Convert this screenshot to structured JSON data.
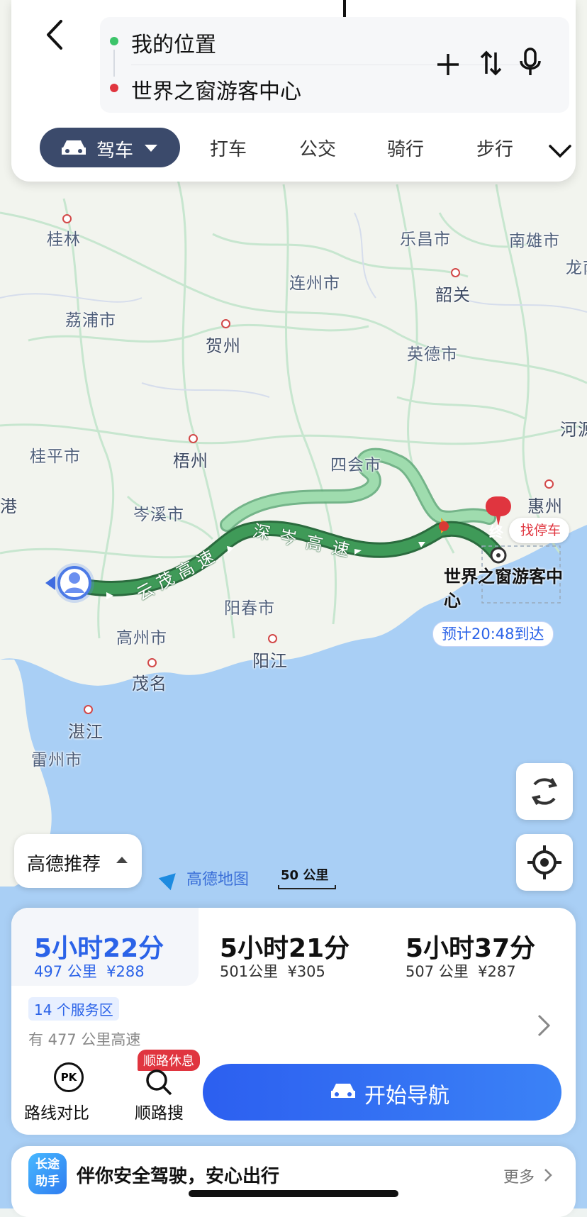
{
  "header": {
    "origin": "我的位置",
    "destination": "世界之窗游客中心",
    "modes": {
      "active": "驾车",
      "taxi": "打车",
      "bus": "公交",
      "bike": "骑行",
      "walk": "步行"
    }
  },
  "map": {
    "cities": [
      "桂林",
      "乐昌市",
      "南雄市",
      "龙南",
      "连州市",
      "韶关",
      "荔浦市",
      "贺州",
      "英德市",
      "河源",
      "桂平市",
      "梧州",
      "四会市",
      "港",
      "惠州",
      "岑溪市",
      "阳春市",
      "高州市",
      "阳江",
      "茂名",
      "湛江",
      "雷州市"
    ],
    "highway_labels": [
      "云茂高速",
      "深岑高速"
    ],
    "destination_label": "世界之窗游客中心",
    "end_marker": "终",
    "find_parking": "找停车",
    "eta": "预计20:48到达",
    "brand": "高德地图",
    "scale": "50 公里"
  },
  "controls": {
    "recommend": "高德推荐"
  },
  "routes": [
    {
      "time": "5小时22分",
      "distance": "497 公里",
      "cost": "¥288",
      "selected": true
    },
    {
      "time": "5小时21分",
      "distance": "501公里",
      "cost": "¥305",
      "selected": false
    },
    {
      "time": "5小时37分",
      "distance": "507 公里",
      "cost": "¥287",
      "selected": false
    }
  ],
  "route_detail": {
    "service_areas": "14 个服务区",
    "highway": "有 477 公里高速"
  },
  "actions": {
    "compare": "路线对比",
    "search": "顺路搜",
    "rest_badge": "顺路休息",
    "start_nav": "开始导航",
    "pk": "PK"
  },
  "helper": {
    "badge_line1": "长途",
    "badge_line2": "助手",
    "text": "伴你安全驾驶，安心出行",
    "more": "更多"
  },
  "colors": {
    "accent": "#2b63e8",
    "route_main": "#2f8a4a",
    "route_alt": "#8fd3a0",
    "sea": "#a9cff5",
    "dest_red": "#e0353f"
  }
}
